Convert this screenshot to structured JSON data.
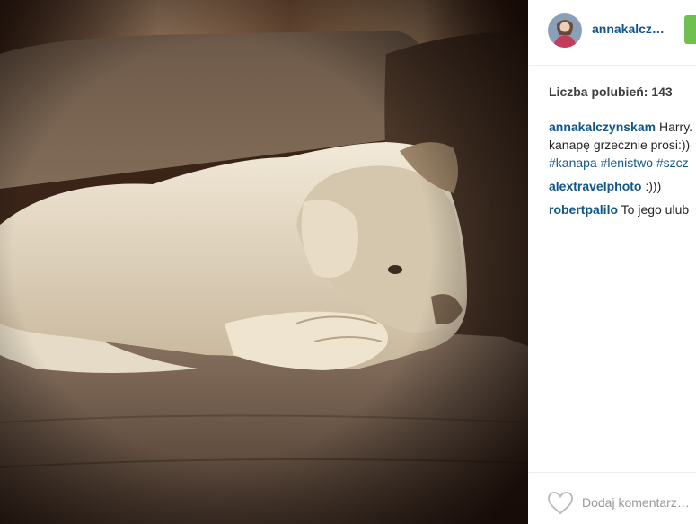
{
  "post": {
    "image_alt": "Photo of a white dog curled up asleep on a beige sofa"
  },
  "header": {
    "username": "annakalcz…"
  },
  "likes": {
    "text": "Liczba polubień: 143"
  },
  "comments": [
    {
      "author": "annakalczynskam",
      "line1": " Harry.",
      "line2": "kanapę grzecznie prosi:))",
      "tags": [
        "#kanapa",
        "#lenistwo",
        "#szcz"
      ]
    },
    {
      "author": "alextravelphoto",
      "text": " :)))"
    },
    {
      "author": "robertpalilo",
      "text": " To jego ulub"
    }
  ],
  "footer": {
    "comment_placeholder": "Dodaj komentarz…"
  },
  "colors": {
    "link": "#125688",
    "follow": "#70c050"
  },
  "icons": {
    "like": "heart-icon",
    "follow": "follow-button"
  }
}
